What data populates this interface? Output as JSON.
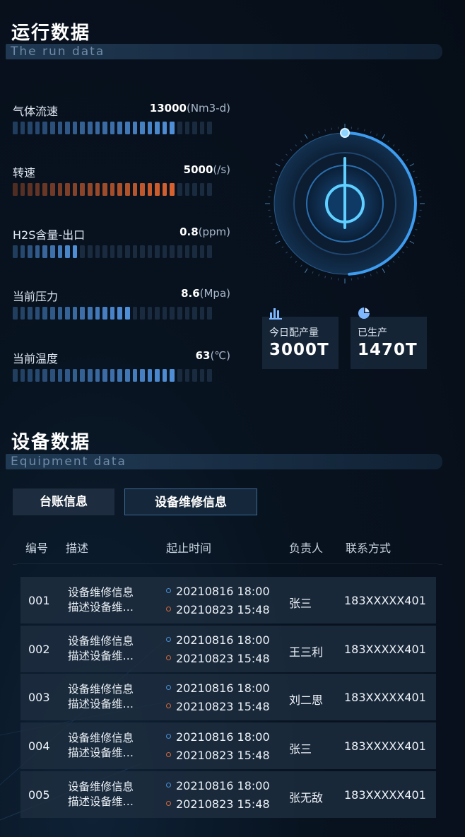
{
  "run": {
    "title": "运行数据",
    "subtitle": "The run data",
    "metrics": [
      {
        "label": "气体流速",
        "value": "13000",
        "unit": "(Nm3-d)",
        "level": 0.8,
        "color": "#4f8fd8"
      },
      {
        "label": "转速",
        "value": "5000",
        "unit": "(/s)",
        "level": 0.8,
        "color": "#d8622f"
      },
      {
        "label": "H2S含量-出口",
        "value": "0.8",
        "unit": "(ppm)",
        "level": 0.35,
        "color": "#4f8fd8"
      },
      {
        "label": "当前压力",
        "value": "8.6",
        "unit": "(Mpa)",
        "level": 0.6,
        "color": "#4f8fd8"
      },
      {
        "label": "当前温度",
        "value": "63",
        "unit": "(℃)",
        "level": 0.8,
        "color": "#4f8fd8"
      }
    ],
    "tiles": [
      {
        "icon": "bar-chart-icon",
        "label": "今日配产量",
        "value": "3000T"
      },
      {
        "icon": "pie-chart-icon",
        "label": "已生产",
        "value": "1470T"
      }
    ],
    "gauge": {
      "progress": 0.49,
      "accent": "#3d9cf0"
    }
  },
  "equipment": {
    "title": "设备数据",
    "subtitle": "Equipment data",
    "tabs": [
      {
        "label": "台账信息",
        "active": false
      },
      {
        "label": "设备维修信息",
        "active": true
      }
    ],
    "columns": [
      "编号",
      "描述",
      "起止时间",
      "负责人",
      "联系方式"
    ],
    "rows": [
      {
        "id": "001",
        "desc1": "设备维修信息",
        "desc2": "描述设备维…",
        "start": "20210816 18:00",
        "end": "20210823 15:48",
        "owner": "张三",
        "phone": "183XXXXX401"
      },
      {
        "id": "002",
        "desc1": "设备维修信息",
        "desc2": "描述设备维…",
        "start": "20210816 18:00",
        "end": "20210823 15:48",
        "owner": "王三利",
        "phone": "183XXXXX401"
      },
      {
        "id": "003",
        "desc1": "设备维修信息",
        "desc2": "描述设备维…",
        "start": "20210816 18:00",
        "end": "20210823 15:48",
        "owner": "刘二思",
        "phone": "183XXXXX401"
      },
      {
        "id": "004",
        "desc1": "设备维修信息",
        "desc2": "描述设备维…",
        "start": "20210816 18:00",
        "end": "20210823 15:48",
        "owner": "张三",
        "phone": "183XXXXX401"
      },
      {
        "id": "005",
        "desc1": "设备维修信息",
        "desc2": "描述设备维…",
        "start": "20210816 18:00",
        "end": "20210823 15:48",
        "owner": "张无敌",
        "phone": "183XXXXX401"
      }
    ]
  }
}
